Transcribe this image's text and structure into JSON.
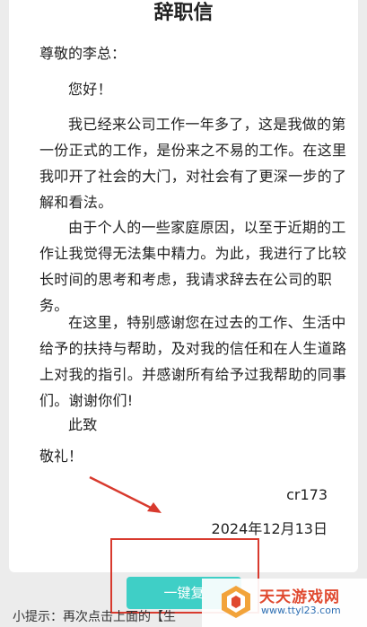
{
  "letter": {
    "title": "辞职信",
    "greeting": "尊敬的李总：",
    "paragraphs": [
      "您好！",
      "我已经来公司工作一年多了，这是我做的第一份正式的工作，是份来之不易的工作。在这里我叩开了社会的大门，对社会有了更深一步的了解和看法。",
      "由于个人的一些家庭原因，以至于近期的工作让我觉得无法集中精力。为此，我进行了比较长时间的思考和考虑，我请求辞去在公司的职务。",
      "在这里，特别感谢您在过去的工作、生活中给予的扶持与帮助，及对我的信任和在人生道路上对我的指引。并感谢所有给予过我帮助的同事们。谢谢你们!",
      "此致"
    ],
    "closing": "敬礼！",
    "signature": "cr173",
    "date": "2024年12月13日"
  },
  "actions": {
    "copy_button_label": "一键复"
  },
  "tip": {
    "text": "小提示：再次点击上面的【生"
  },
  "watermark": {
    "title": "天天游戏网",
    "url": "www.ttyl23.com",
    "icon": "game-logo-icon"
  },
  "colors": {
    "button": "#3fcfc6",
    "annotation": "#d83a2e"
  }
}
